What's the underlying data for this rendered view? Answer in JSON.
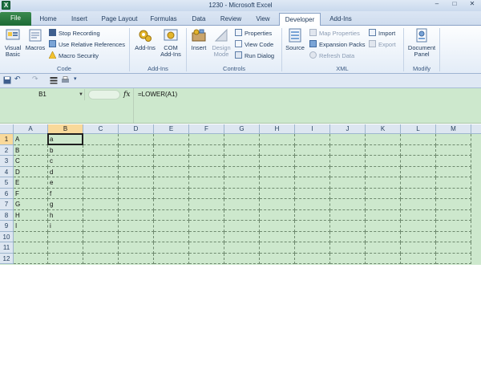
{
  "window": {
    "title": "1230 - Microsoft Excel",
    "app_icon": "X",
    "min": "–",
    "max": "□",
    "close": "✕"
  },
  "qat_top": {
    "save": "💾",
    "undo": "↶",
    "redo": "↷"
  },
  "tabs": [
    {
      "label": "File",
      "active": false,
      "file": true
    },
    {
      "label": "Home",
      "active": false
    },
    {
      "label": "Insert",
      "active": false
    },
    {
      "label": "Page Layout",
      "active": false
    },
    {
      "label": "Formulas",
      "active": false
    },
    {
      "label": "Data",
      "active": false
    },
    {
      "label": "Review",
      "active": false
    },
    {
      "label": "View",
      "active": false
    },
    {
      "label": "Developer",
      "active": true
    },
    {
      "label": "Add-Ins",
      "active": false
    }
  ],
  "ribbon": {
    "code": {
      "label": "Code",
      "visual_basic": "Visual Basic",
      "macros": "Macros",
      "stop_recording": "Stop Recording",
      "relative_refs": "Use Relative References",
      "macro_security": "Macro Security"
    },
    "addins": {
      "label": "Add-Ins",
      "add_ins": "Add-Ins",
      "com_add_ins": "COM Add-Ins"
    },
    "controls": {
      "label": "Controls",
      "insert": "Insert",
      "design_mode": "Design Mode",
      "properties": "Properties",
      "view_code": "View Code",
      "run_dialog": "Run Dialog"
    },
    "xml": {
      "label": "XML",
      "source": "Source",
      "map_properties": "Map Properties",
      "expansion_packs": "Expansion Packs",
      "refresh_data": "Refresh Data",
      "import": "Import",
      "export": "Export"
    },
    "modify": {
      "label": "Modify",
      "document_panel": "Document Panel"
    }
  },
  "formula_bar": {
    "name_box": "B1",
    "fx": "fx",
    "formula": "=LOWER(A1)"
  },
  "sheet": {
    "columns": [
      "A",
      "B",
      "C",
      "D",
      "E",
      "F",
      "G",
      "H",
      "I",
      "J",
      "K",
      "L",
      "M"
    ],
    "rows": [
      "1",
      "2",
      "3",
      "4",
      "5",
      "6",
      "7",
      "8",
      "9",
      "10",
      "11",
      "12"
    ],
    "selected_col": "B",
    "selected_row": "1",
    "col_a": [
      "A",
      "B",
      "C",
      "D",
      "E",
      "F",
      "G",
      "H",
      "I",
      "",
      "",
      ""
    ],
    "col_b": [
      "a",
      "b",
      "c",
      "d",
      "e",
      "f",
      "g",
      "h",
      "i",
      "",
      "",
      ""
    ]
  },
  "colors": {
    "accent_green": "#1f7244",
    "sheet_bg": "#cde8cd",
    "selection": "#f9d99a"
  }
}
